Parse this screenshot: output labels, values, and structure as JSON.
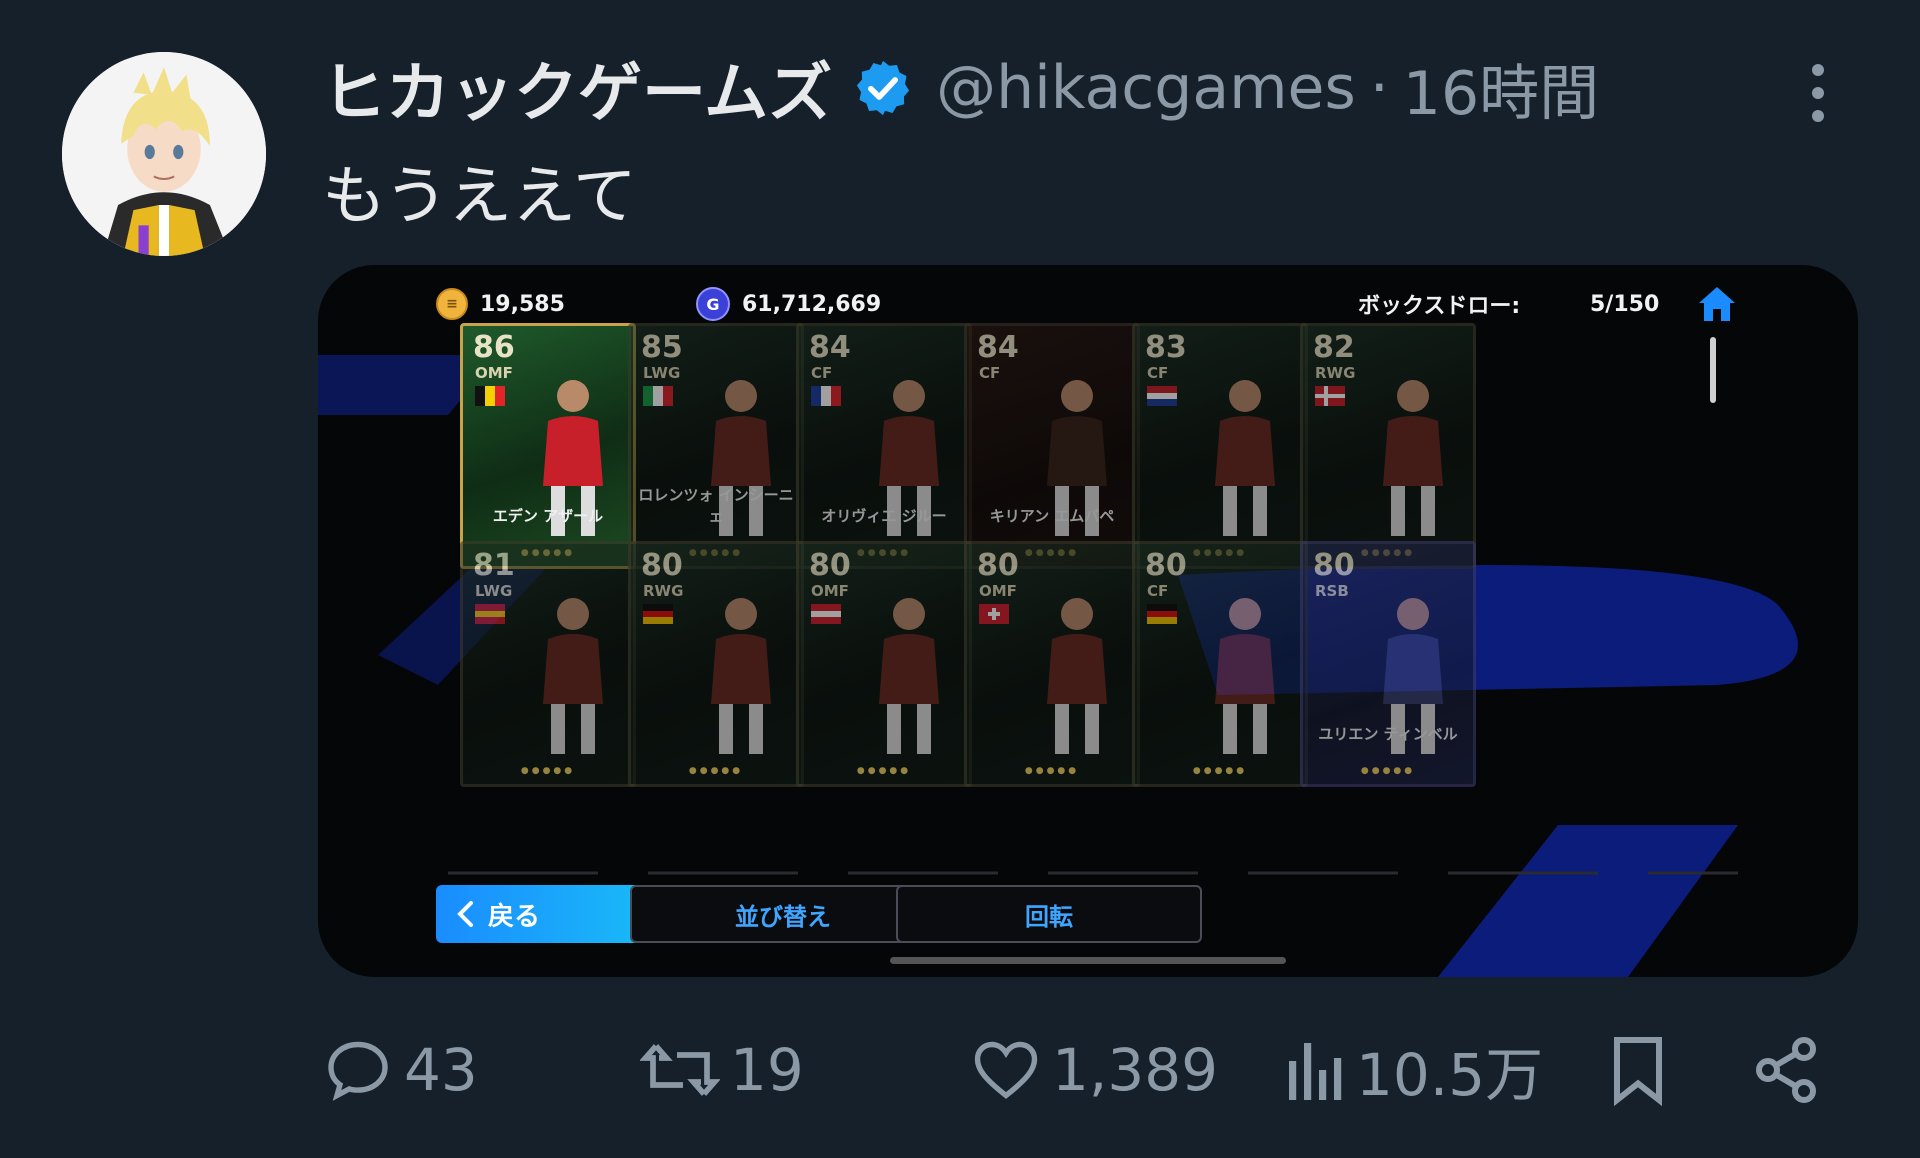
{
  "tweet": {
    "author_name": "ヒカックゲームズ",
    "handle": "@hikacgames",
    "separator": "·",
    "time": "16時間",
    "text": "もうええて"
  },
  "media": {
    "hud": {
      "coins": "19,585",
      "gp": "61,712,669",
      "box_label": "ボックスドロー:",
      "box_count": "5/150"
    },
    "cards": [
      {
        "rating": "86",
        "pos": "OMF",
        "name": "エデン アザール",
        "style": "active",
        "flag": "be"
      },
      {
        "rating": "85",
        "pos": "LWG",
        "name": "ロレンツォ インシーニェ",
        "style": "normal",
        "flag": "it"
      },
      {
        "rating": "84",
        "pos": "CF",
        "name": "オリヴィエ ジルー",
        "style": "normal",
        "flag": "fr"
      },
      {
        "rating": "84",
        "pos": "CF",
        "name": "キリアン エムバペ",
        "style": "dark",
        "flag": "none"
      },
      {
        "rating": "83",
        "pos": "CF",
        "name": "",
        "style": "normal",
        "flag": "nl"
      },
      {
        "rating": "82",
        "pos": "RWG",
        "name": "",
        "style": "normal",
        "flag": "dk"
      },
      {
        "rating": "81",
        "pos": "LWG",
        "name": "",
        "style": "normal",
        "flag": "es"
      },
      {
        "rating": "80",
        "pos": "RWG",
        "name": "",
        "style": "normal",
        "flag": "de"
      },
      {
        "rating": "80",
        "pos": "OMF",
        "name": "",
        "style": "normal",
        "flag": "at"
      },
      {
        "rating": "80",
        "pos": "OMF",
        "name": "",
        "style": "normal",
        "flag": "ch"
      },
      {
        "rating": "80",
        "pos": "CF",
        "name": "",
        "style": "normal",
        "flag": "de"
      },
      {
        "rating": "80",
        "pos": "RSB",
        "name": "ユリエン ティンベル",
        "style": "purple",
        "flag": "none"
      }
    ],
    "buttons": {
      "back": "戻る",
      "sort": "並び替え",
      "rotate": "回転"
    }
  },
  "actions": {
    "replies": "43",
    "retweets": "19",
    "likes": "1,389",
    "views": "10.5万"
  },
  "colors": {
    "background": "#15202b",
    "secondary_text": "#8b98a5",
    "verified": "#1d9bf0",
    "accent_blue": "#1a8cff"
  }
}
